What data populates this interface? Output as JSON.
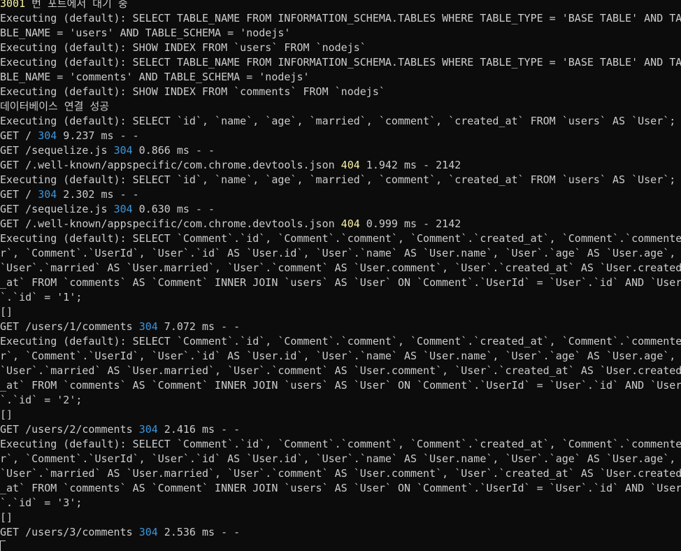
{
  "terminal": {
    "lines": [
      {
        "segments": [
          {
            "text": "3001",
            "color": "yellow"
          },
          {
            "text": " 번 포트에서 대기 중"
          }
        ]
      },
      {
        "segments": [
          {
            "text": "Executing (default): SELECT TABLE_NAME FROM INFORMATION_SCHEMA.TABLES WHERE TABLE_TYPE = 'BASE TABLE' AND TA"
          }
        ]
      },
      {
        "segments": [
          {
            "text": "BLE_NAME = 'users' AND TABLE_SCHEMA = 'nodejs'"
          }
        ]
      },
      {
        "segments": [
          {
            "text": "Executing (default): SHOW INDEX FROM `users` FROM `nodejs`"
          }
        ]
      },
      {
        "segments": [
          {
            "text": "Executing (default): SELECT TABLE_NAME FROM INFORMATION_SCHEMA.TABLES WHERE TABLE_TYPE = 'BASE TABLE' AND TA"
          }
        ]
      },
      {
        "segments": [
          {
            "text": "BLE_NAME = 'comments' AND TABLE_SCHEMA = 'nodejs'"
          }
        ]
      },
      {
        "segments": [
          {
            "text": "Executing (default): SHOW INDEX FROM `comments` FROM `nodejs`"
          }
        ]
      },
      {
        "segments": [
          {
            "text": "데이터베이스 연결 성공"
          }
        ]
      },
      {
        "segments": [
          {
            "text": "Executing (default): SELECT `id`, `name`, `age`, `married`, `comment`, `created_at` FROM `users` AS `User`;"
          }
        ]
      },
      {
        "segments": [
          {
            "text": "GET / "
          },
          {
            "text": "304",
            "color": "cyan"
          },
          {
            "text": " 9.237 ms - -"
          }
        ]
      },
      {
        "segments": [
          {
            "text": "GET /sequelize.js "
          },
          {
            "text": "304",
            "color": "cyan"
          },
          {
            "text": " 0.866 ms - -"
          }
        ]
      },
      {
        "segments": [
          {
            "text": "GET /.well-known/appspecific/com.chrome.devtools.json "
          },
          {
            "text": "404",
            "color": "yellow"
          },
          {
            "text": " 1.942 ms - 2142"
          }
        ]
      },
      {
        "segments": [
          {
            "text": "Executing (default): SELECT `id`, `name`, `age`, `married`, `comment`, `created_at` FROM `users` AS `User`;"
          }
        ]
      },
      {
        "segments": [
          {
            "text": "GET / "
          },
          {
            "text": "304",
            "color": "cyan"
          },
          {
            "text": " 2.302 ms - -"
          }
        ]
      },
      {
        "segments": [
          {
            "text": "GET /sequelize.js "
          },
          {
            "text": "304",
            "color": "cyan"
          },
          {
            "text": " 0.630 ms - -"
          }
        ]
      },
      {
        "segments": [
          {
            "text": "GET /.well-known/appspecific/com.chrome.devtools.json "
          },
          {
            "text": "404",
            "color": "yellow"
          },
          {
            "text": " 0.999 ms - 2142"
          }
        ]
      },
      {
        "segments": [
          {
            "text": "Executing (default): SELECT `Comment`.`id`, `Comment`.`comment`, `Comment`.`created_at`, `Comment`.`commente"
          }
        ]
      },
      {
        "segments": [
          {
            "text": "r`, `Comment`.`UserId`, `User`.`id` AS `User.id`, `User`.`name` AS `User.name`, `User`.`age` AS `User.age`,"
          }
        ]
      },
      {
        "segments": [
          {
            "text": "`User`.`married` AS `User.married`, `User`.`comment` AS `User.comment`, `User`.`created_at` AS `User.created"
          }
        ]
      },
      {
        "segments": [
          {
            "text": "_at` FROM `comments` AS `Comment` INNER JOIN `users` AS `User` ON `Comment`.`UserId` = `User`.`id` AND `User"
          }
        ]
      },
      {
        "segments": [
          {
            "text": "`.`id` = '1';"
          }
        ]
      },
      {
        "segments": [
          {
            "text": "[]"
          }
        ]
      },
      {
        "segments": [
          {
            "text": "GET /users/1/comments "
          },
          {
            "text": "304",
            "color": "cyan"
          },
          {
            "text": " 7.072 ms - -"
          }
        ]
      },
      {
        "segments": [
          {
            "text": "Executing (default): SELECT `Comment`.`id`, `Comment`.`comment`, `Comment`.`created_at`, `Comment`.`commente"
          }
        ]
      },
      {
        "segments": [
          {
            "text": "r`, `Comment`.`UserId`, `User`.`id` AS `User.id`, `User`.`name` AS `User.name`, `User`.`age` AS `User.age`,"
          }
        ]
      },
      {
        "segments": [
          {
            "text": "`User`.`married` AS `User.married`, `User`.`comment` AS `User.comment`, `User`.`created_at` AS `User.created"
          }
        ]
      },
      {
        "segments": [
          {
            "text": "_at` FROM `comments` AS `Comment` INNER JOIN `users` AS `User` ON `Comment`.`UserId` = `User`.`id` AND `User"
          }
        ]
      },
      {
        "segments": [
          {
            "text": "`.`id` = '2';"
          }
        ]
      },
      {
        "segments": [
          {
            "text": "[]"
          }
        ]
      },
      {
        "segments": [
          {
            "text": "GET /users/2/comments "
          },
          {
            "text": "304",
            "color": "cyan"
          },
          {
            "text": " 2.416 ms - -"
          }
        ]
      },
      {
        "segments": [
          {
            "text": "Executing (default): SELECT `Comment`.`id`, `Comment`.`comment`, `Comment`.`created_at`, `Comment`.`commente"
          }
        ]
      },
      {
        "segments": [
          {
            "text": "r`, `Comment`.`UserId`, `User`.`id` AS `User.id`, `User`.`name` AS `User.name`, `User`.`age` AS `User.age`,"
          }
        ]
      },
      {
        "segments": [
          {
            "text": "`User`.`married` AS `User.married`, `User`.`comment` AS `User.comment`, `User`.`created_at` AS `User.created"
          }
        ]
      },
      {
        "segments": [
          {
            "text": "_at` FROM `comments` AS `Comment` INNER JOIN `users` AS `User` ON `Comment`.`UserId` = `User`.`id` AND `User"
          }
        ]
      },
      {
        "segments": [
          {
            "text": "`.`id` = '3';"
          }
        ]
      },
      {
        "segments": [
          {
            "text": "[]"
          }
        ]
      },
      {
        "segments": [
          {
            "text": "GET /users/3/comments "
          },
          {
            "text": "304",
            "color": "cyan"
          },
          {
            "text": " 2.536 ms - -"
          }
        ]
      }
    ]
  },
  "colors": {
    "background": "#0c0c0c",
    "foreground": "#cccccc",
    "yellow": "#f9f1a5",
    "cyan": "#3a96dd"
  }
}
